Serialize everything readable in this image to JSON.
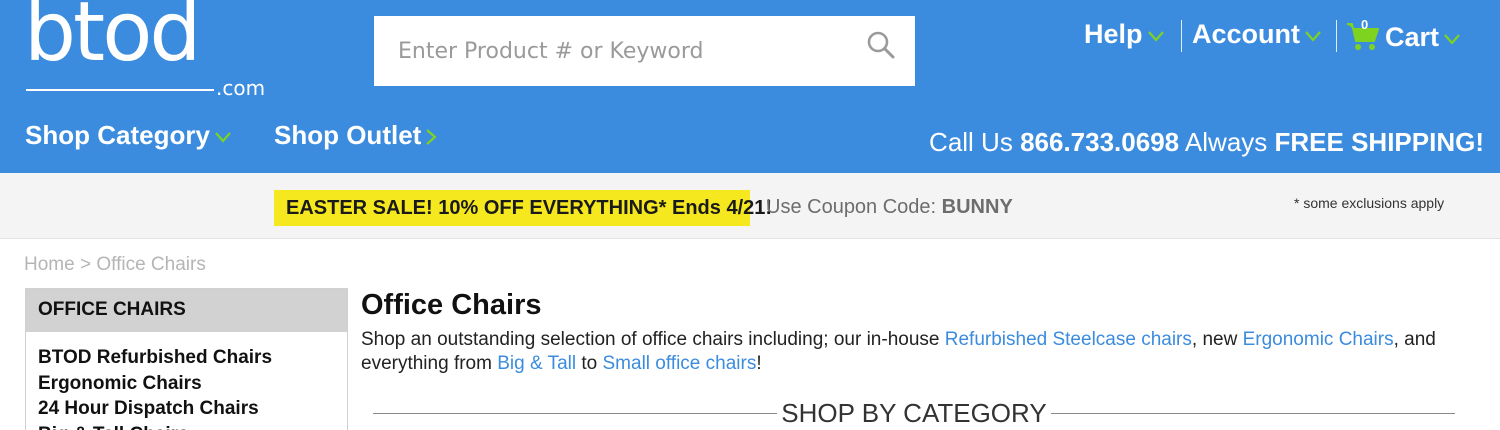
{
  "header": {
    "logo": {
      "word": "btod",
      "suffix": ".com"
    },
    "search": {
      "placeholder": "Enter Product # or Keyword",
      "value": ""
    },
    "links": {
      "help": "Help",
      "account": "Account",
      "cart": "Cart",
      "cart_count": "0"
    },
    "nav": {
      "shop_category": "Shop Category",
      "shop_outlet": "Shop Outlet"
    },
    "callus": {
      "prefix": "Call Us",
      "phone": "866.733.0698",
      "middle": "Always",
      "shipping": "FREE SHIPPING!"
    }
  },
  "promo": {
    "sale": "EASTER SALE! 10% OFF EVERYTHING* Ends 4/21!",
    "coupon_label": "Use Coupon Code:",
    "coupon_code": "BUNNY",
    "exclusions": "* some exclusions apply"
  },
  "breadcrumb": {
    "home": "Home",
    "separator": ">",
    "current": "Office Chairs"
  },
  "sidebar": {
    "heading": "OFFICE CHAIRS",
    "items": [
      {
        "label": "BTOD Refurbished Chairs"
      },
      {
        "label": "Ergonomic Chairs"
      },
      {
        "label": "24 Hour Dispatch Chairs"
      },
      {
        "label": "Big & Tall Chairs"
      }
    ]
  },
  "main": {
    "title": "Office Chairs",
    "intro": {
      "t1": "Shop an outstanding selection of office chairs including; our in-house ",
      "link1": "Refurbished Steelcase chairs",
      "t2": ", new ",
      "link2": "Ergonomic Chairs",
      "t3": ", and everything from ",
      "link3": "Big & Tall",
      "t4": " to ",
      "link4": "Small office chairs",
      "t5": "!"
    },
    "section_heading": "SHOP BY CATEGORY"
  },
  "colors": {
    "brand_blue": "#3b8cde",
    "accent_green": "#7ed321",
    "promo_yellow": "#f5e81f",
    "link_blue": "#3b8cde"
  },
  "icons": {
    "search": "magnifier-icon",
    "cart": "shopping-cart-icon",
    "dropdown": "chevron-down-icon",
    "outlet": "chevron-right-icon"
  }
}
